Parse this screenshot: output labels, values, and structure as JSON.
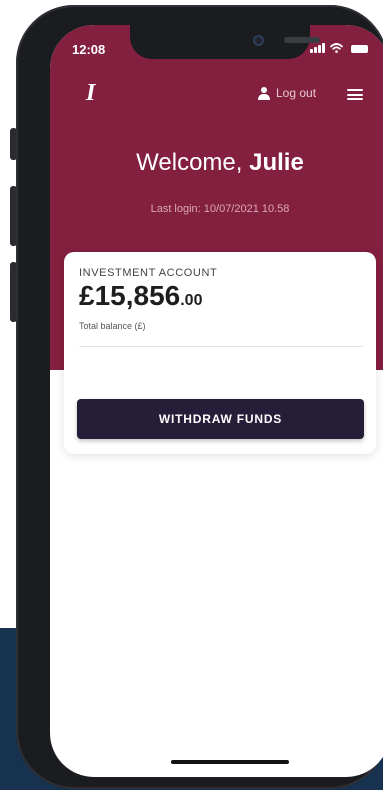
{
  "status_bar": {
    "time": "12:08"
  },
  "header": {
    "logo": "I",
    "logout_label": "Log out",
    "welcome_prefix": "Welcome,",
    "user_name": "Julie",
    "last_login": "Last login: 10/07/2021 10.58"
  },
  "account": {
    "title": "INVESTMENT ACCOUNT",
    "balance_main": "£15,856",
    "balance_decimals": ".00",
    "balance_caption": "Total balance (£)",
    "withdraw_label": "WITHDRAW FUNDS"
  },
  "colors": {
    "header_bg": "#84203f",
    "button_bg": "#261d38",
    "page_bg_lower": "#16324f"
  },
  "icons": [
    "user-icon",
    "hamburger-menu-icon",
    "signal-icon",
    "wifi-icon",
    "battery-icon"
  ]
}
